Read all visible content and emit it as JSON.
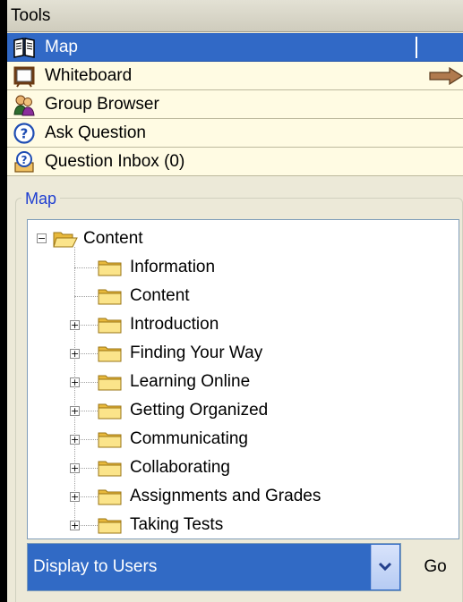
{
  "tools": {
    "header": "Tools",
    "items": [
      {
        "label": "Map",
        "icon": "book-icon",
        "selected": true
      },
      {
        "label": "Whiteboard",
        "icon": "whiteboard-icon",
        "selected": false
      },
      {
        "label": "Group Browser",
        "icon": "group-icon",
        "selected": false
      },
      {
        "label": "Ask Question",
        "icon": "question-icon",
        "selected": false
      },
      {
        "label": "Question Inbox (0)",
        "icon": "question-inbox-icon",
        "selected": false
      }
    ]
  },
  "map": {
    "legend": "Map",
    "root": {
      "label": "Content",
      "expanded": true
    },
    "children": [
      {
        "label": "Information",
        "expandable": false
      },
      {
        "label": "Content",
        "expandable": false
      },
      {
        "label": "Introduction",
        "expandable": true
      },
      {
        "label": "Finding Your Way",
        "expandable": true
      },
      {
        "label": "Learning Online",
        "expandable": true
      },
      {
        "label": "Getting Organized",
        "expandable": true
      },
      {
        "label": "Communicating",
        "expandable": true
      },
      {
        "label": "Collaborating",
        "expandable": true
      },
      {
        "label": "Assignments and Grades",
        "expandable": true
      },
      {
        "label": "Taking Tests",
        "expandable": true
      }
    ]
  },
  "controls": {
    "display_select": "Display to Users",
    "go_label": "Go"
  },
  "colors": {
    "selection": "#3169c6",
    "folder": "#f4d35e",
    "legend": "#1f3fd1",
    "panel": "#ece9d8",
    "tool_row": "#fffbe3"
  }
}
